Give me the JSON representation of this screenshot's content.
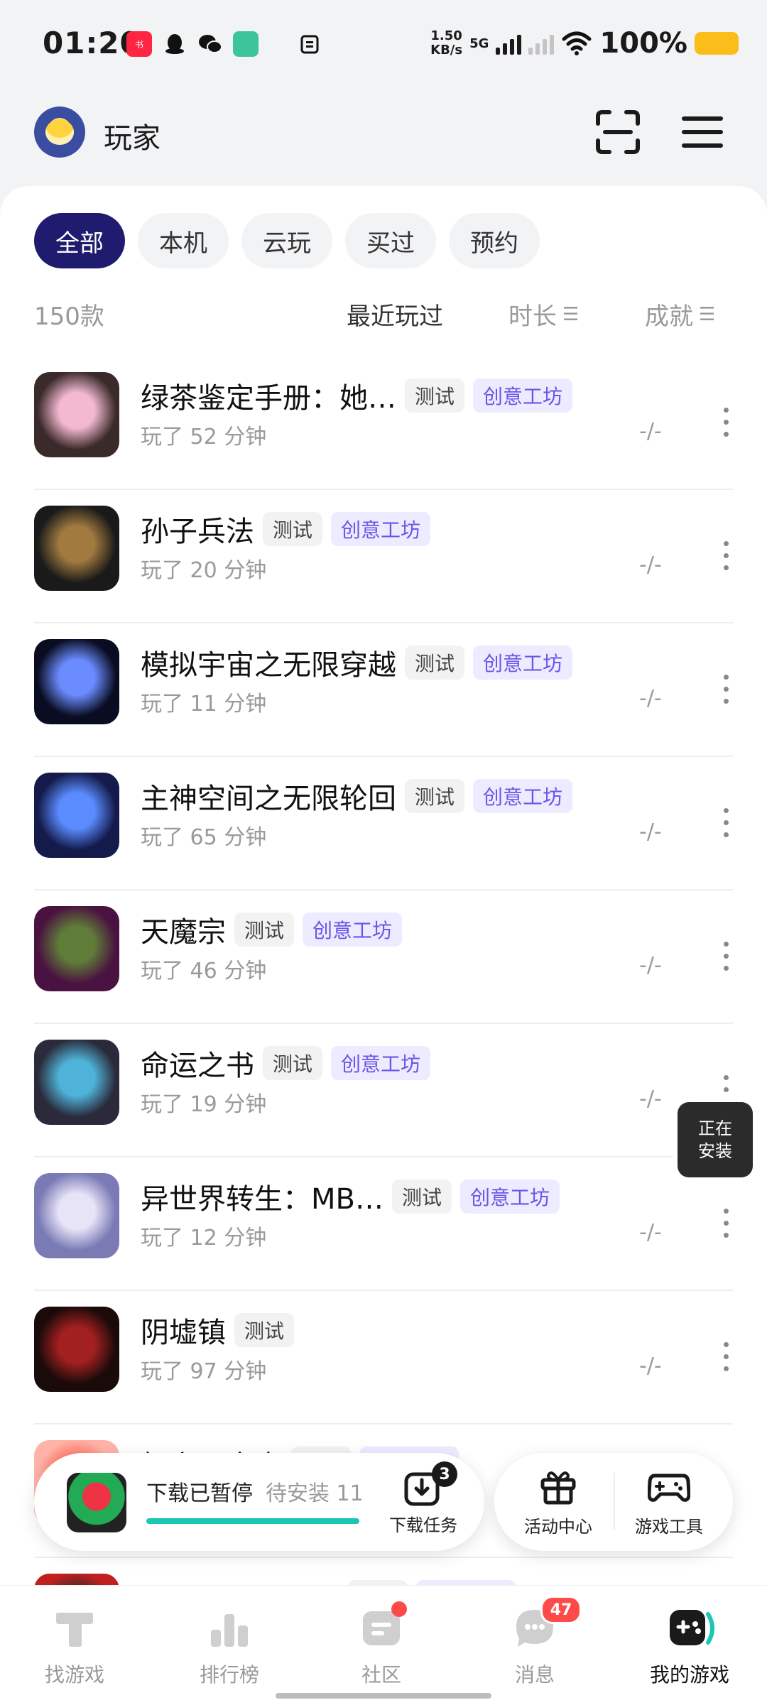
{
  "status_bar": {
    "time": "01:20",
    "app_icons": [
      "xiaohongshu-icon",
      "qq-icon",
      "wechat-icon",
      "app-icon",
      "clipboard-icon"
    ],
    "net_speed_value": "1.50",
    "net_speed_unit": "KB/s",
    "network": "5G",
    "battery": "100%"
  },
  "header": {
    "player_name": "玩家"
  },
  "filters": [
    "全部",
    "本机",
    "云玩",
    "买过",
    "预约"
  ],
  "active_filter": 0,
  "list_meta": {
    "count": "150款",
    "sort_recent": "最近玩过",
    "sort_duration": "时长",
    "sort_achievement": "成就"
  },
  "games": [
    {
      "title": "绿茶鉴定手册：她…",
      "tags": [
        "测试",
        "创意工坊"
      ],
      "playtime": "玩了 52 分钟",
      "score": "-/-",
      "icon_colors": [
        "#f3b9d1",
        "#3b2a2a"
      ]
    },
    {
      "title": "孙子兵法",
      "tags": [
        "测试",
        "创意工坊"
      ],
      "playtime": "玩了 20 分钟",
      "score": "-/-",
      "icon_colors": [
        "#a07a3f",
        "#1a1a1a"
      ]
    },
    {
      "title": "模拟宇宙之无限穿越",
      "tags": [
        "测试",
        "创意工坊"
      ],
      "playtime": "玩了 11 分钟",
      "score": "-/-",
      "icon_colors": [
        "#6a8cff",
        "#0a0d22"
      ]
    },
    {
      "title": "主神空间之无限轮回",
      "tags": [
        "测试",
        "创意工坊"
      ],
      "playtime": "玩了 65 分钟",
      "score": "-/-",
      "icon_colors": [
        "#5a8cff",
        "#141a4a"
      ]
    },
    {
      "title": "天魔宗",
      "tags": [
        "测试",
        "创意工坊"
      ],
      "playtime": "玩了 46 分钟",
      "score": "-/-",
      "icon_colors": [
        "#5f7d38",
        "#4a1240"
      ]
    },
    {
      "title": "命运之书",
      "tags": [
        "测试",
        "创意工坊"
      ],
      "playtime": "玩了 19 分钟",
      "score": "-/-",
      "icon_colors": [
        "#4fb3d9",
        "#2a2a3a"
      ]
    },
    {
      "title": "异世界转生：MB…",
      "tags": [
        "测试",
        "创意工坊"
      ],
      "playtime": "玩了 12 分钟",
      "score": "-/-",
      "icon_colors": [
        "#e8e4f8",
        "#7a7ab5"
      ]
    },
    {
      "title": "阴墟镇",
      "tags": [
        "测试"
      ],
      "playtime": "玩了 97 分钟",
      "score": "-/-",
      "icon_colors": [
        "#a32020",
        "#1a0a0a"
      ]
    },
    {
      "title": "相亲那点事",
      "tags": [
        "测试",
        "创意工坊"
      ],
      "playtime": "",
      "score": "",
      "icon_colors": [
        "#ff6b5a",
        "#ffb3a8"
      ]
    },
    {
      "title": "异常调查指挥官",
      "tags": [
        "测试",
        "创意工坊"
      ],
      "playtime": "",
      "score": "",
      "icon_colors": [
        "#2a2a2a",
        "#c02020"
      ]
    }
  ],
  "installing_float": {
    "line1": "正在",
    "line2": "安装"
  },
  "download_bar": {
    "status": "下载已暂停",
    "pending": "待安装 11",
    "progress": 1.0,
    "task_label": "下载任务",
    "task_badge": "3"
  },
  "tools": {
    "activity_label": "活动中心",
    "gametool_label": "游戏工具"
  },
  "bottom_nav": [
    {
      "label": "找游戏",
      "icon": "find-games-icon"
    },
    {
      "label": "排行榜",
      "icon": "ranking-icon"
    },
    {
      "label": "社区",
      "icon": "community-icon",
      "dot": true
    },
    {
      "label": "消息",
      "icon": "message-icon",
      "badge": "47"
    },
    {
      "label": "我的游戏",
      "icon": "my-games-icon",
      "active": true
    }
  ],
  "colors": {
    "accent": "#1f1b6f",
    "workshop_tag": "#6c55e6",
    "progress": "#19c7b3",
    "badge_red": "#ff4a4a"
  }
}
